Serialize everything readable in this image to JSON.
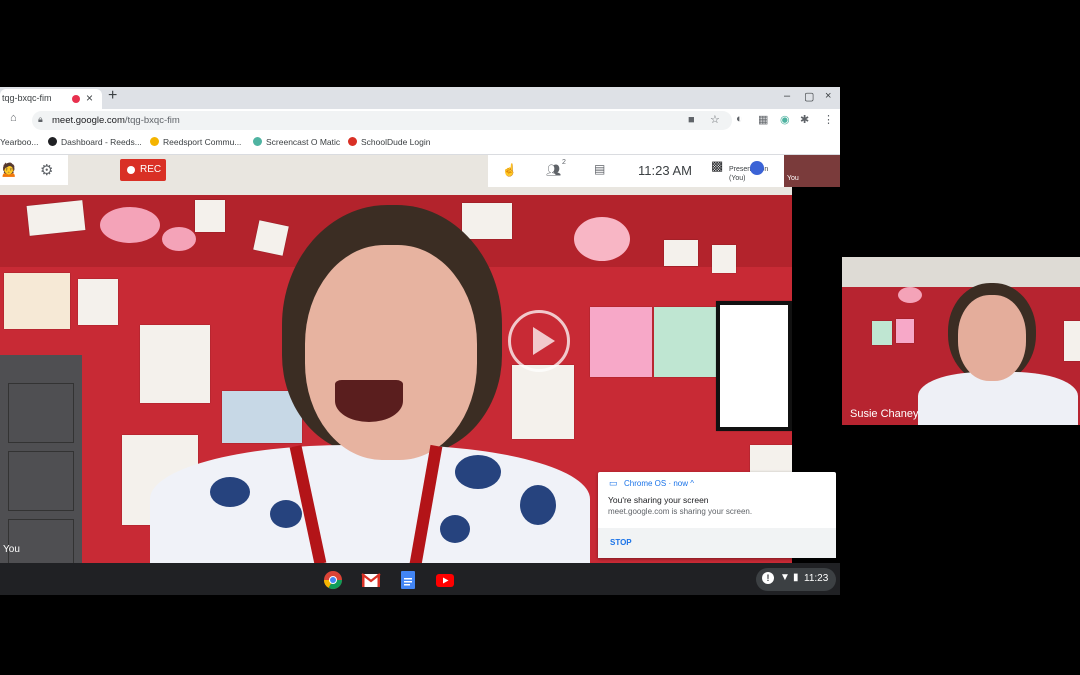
{
  "browser": {
    "tab_title": "tqg-bxqc-fim",
    "new_tab": "+",
    "close_tab": "×",
    "url_host": "meet.google.com",
    "url_path": "/tqg-bxqc-fim",
    "window_min": "–",
    "window_max": "▢",
    "window_close": "×"
  },
  "bookmarks": [
    {
      "label": "Yearboo...",
      "color": "#ffffff"
    },
    {
      "label": "Dashboard - Reeds...",
      "color": "#202124"
    },
    {
      "label": "Reedsport Commu...",
      "color": "#f4b400"
    },
    {
      "label": "Screencast O Matic",
      "color": "#4fb3a1"
    },
    {
      "label": "SchoolDude Login",
      "color": "#d93025"
    }
  ],
  "meet": {
    "rec_label": "REC",
    "clock": "11:23 AM",
    "participants_count": "2",
    "presenter_label": "Presentation (You)",
    "self_label": "You",
    "mini_tile_label": "You"
  },
  "notification": {
    "app": "Chrome OS · now ^",
    "title": "You're sharing your screen",
    "body": "meet.google.com is sharing your screen.",
    "action": "STOP"
  },
  "shelf": {
    "time": "11:23",
    "apps": [
      "chrome-icon",
      "gmail-icon",
      "docs-icon",
      "youtube-icon"
    ]
  },
  "participant_tile": {
    "name": "Susie Chaney"
  },
  "colors": {
    "rec_red": "#d93025",
    "accent_blue": "#1a73e8",
    "shelf": "#202124"
  }
}
